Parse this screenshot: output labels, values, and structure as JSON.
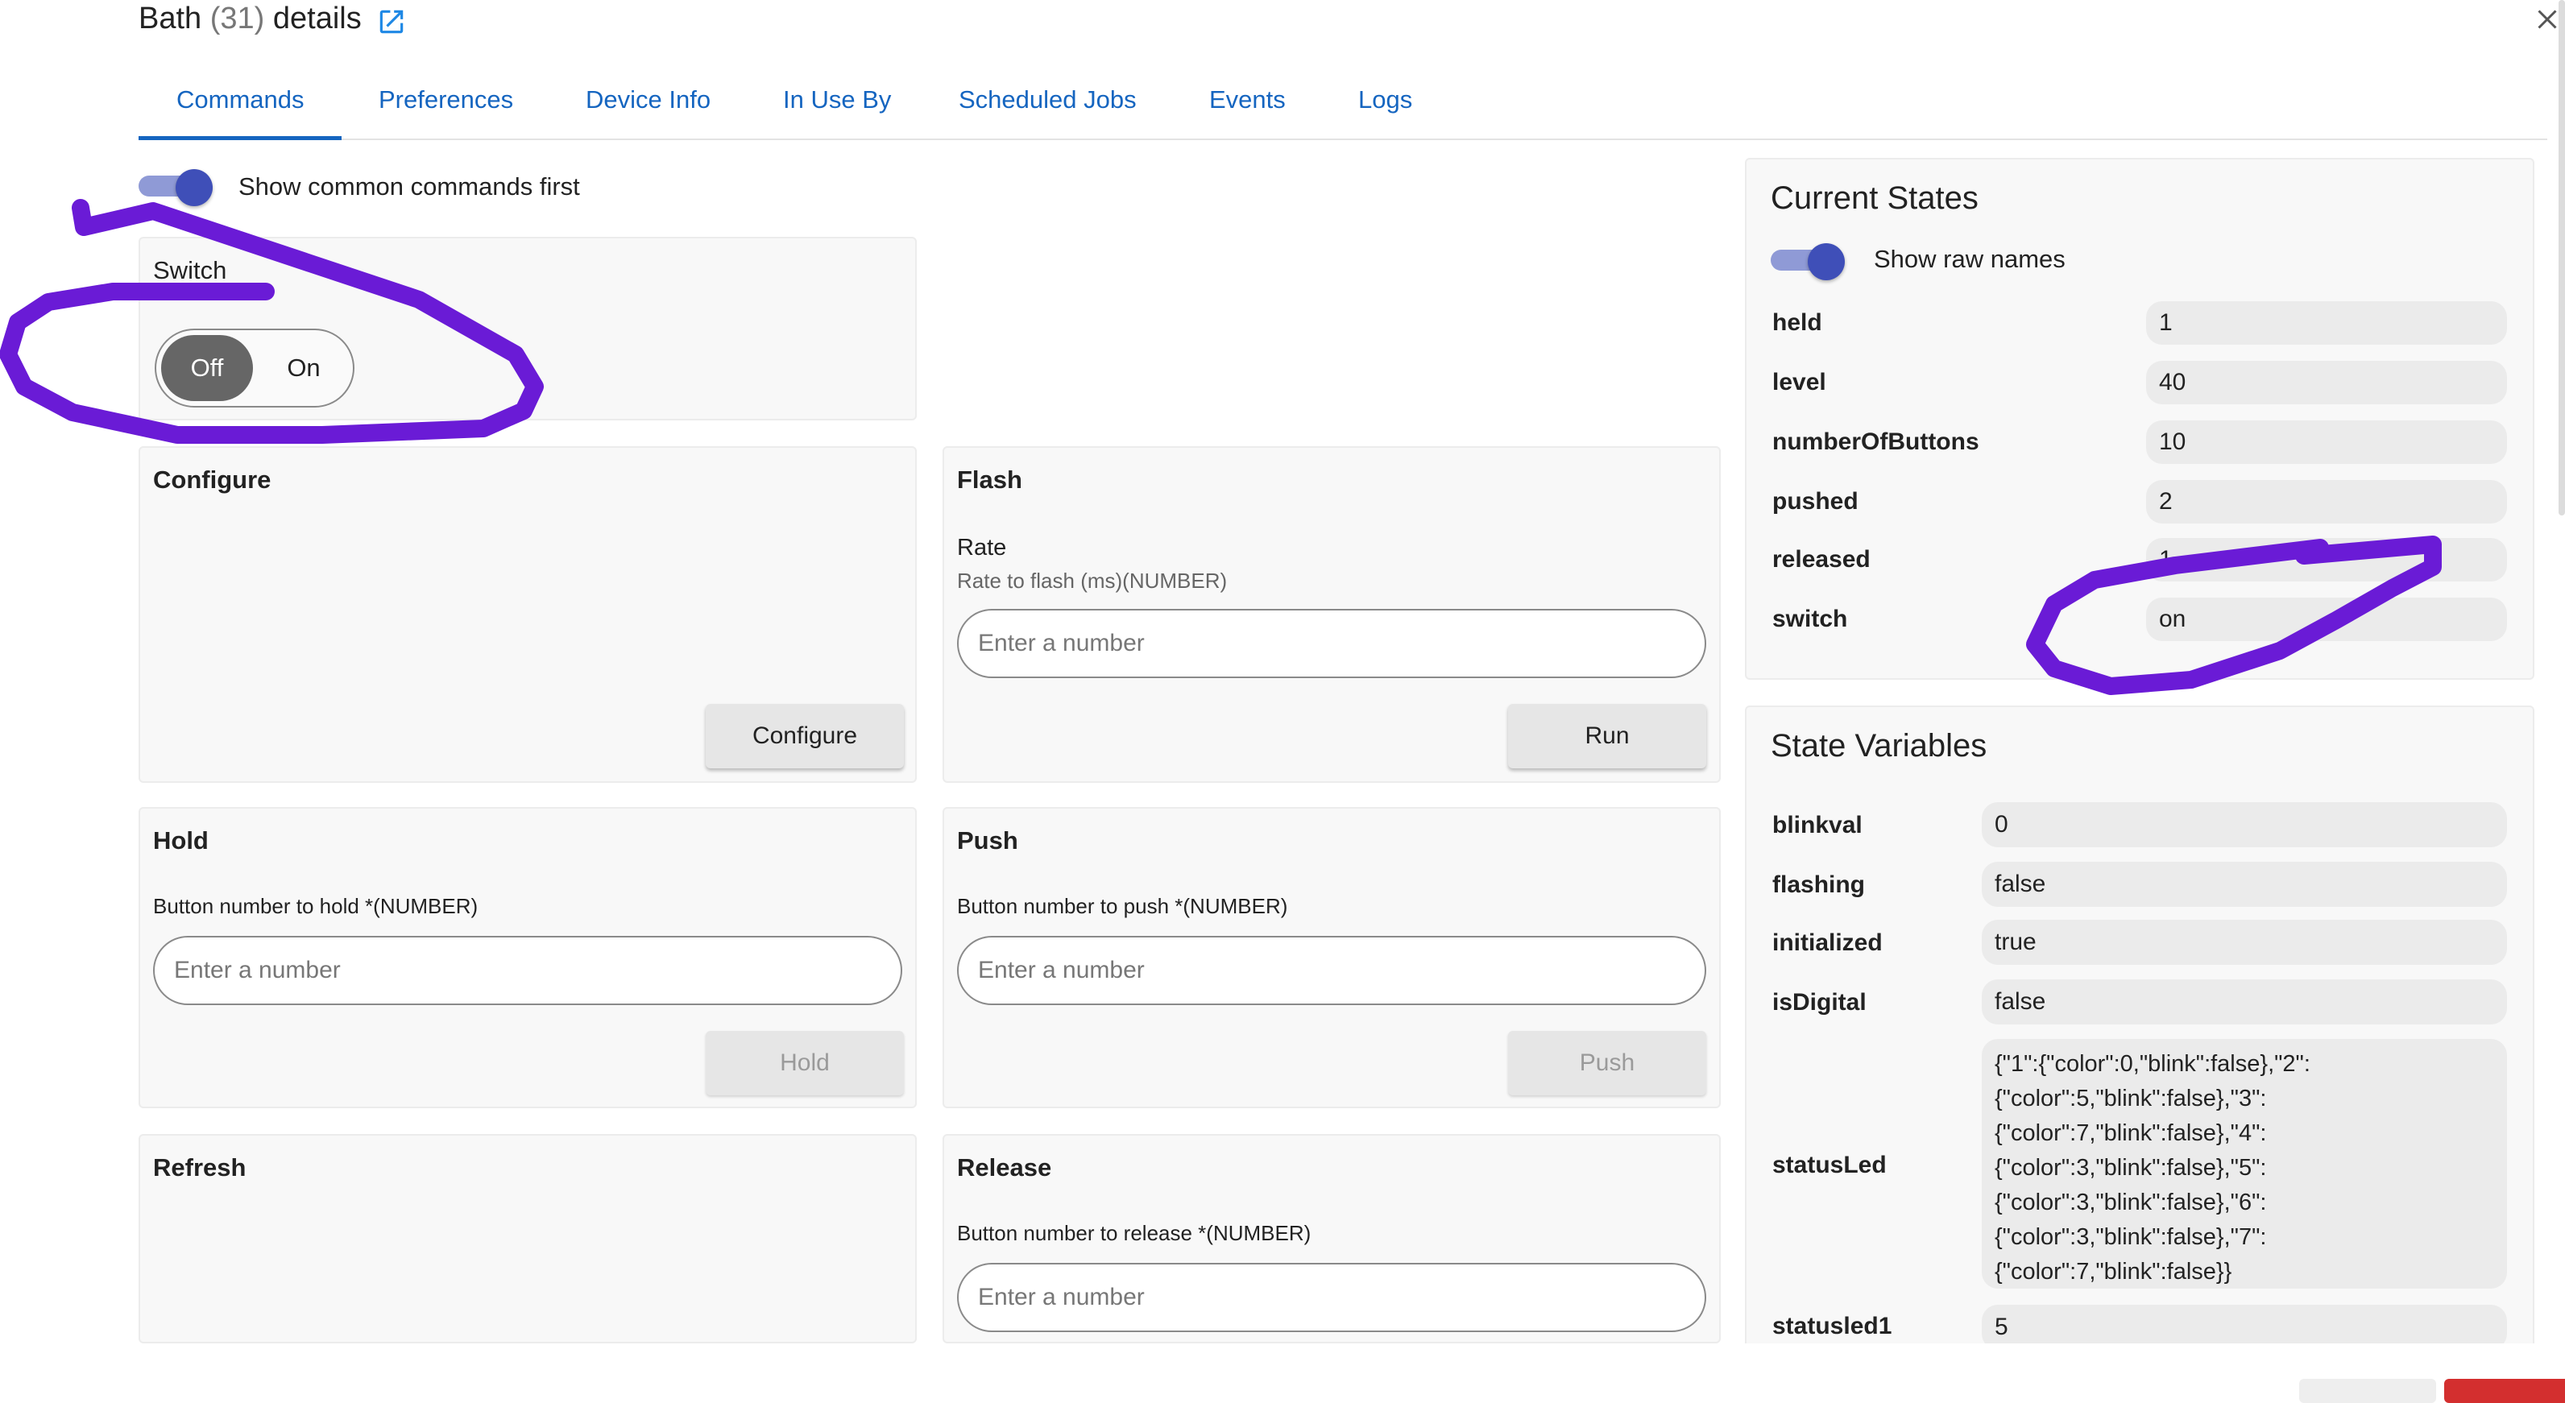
{
  "header": {
    "title_prefix": "Bath",
    "title_count": "(31)",
    "title_suffix": "details",
    "open_icon": "external-link-icon",
    "close_icon": "close-icon"
  },
  "tabs": [
    {
      "label": "Commands",
      "active": true
    },
    {
      "label": "Preferences"
    },
    {
      "label": "Device Info"
    },
    {
      "label": "In Use By"
    },
    {
      "label": "Scheduled Jobs"
    },
    {
      "label": "Events"
    },
    {
      "label": "Logs"
    }
  ],
  "commands": {
    "common_first_label": "Show common commands first",
    "switch": {
      "title": "Switch",
      "off_label": "Off",
      "on_label": "On",
      "selected": "Off"
    },
    "configure": {
      "title": "Configure",
      "button": "Configure"
    },
    "flash": {
      "title": "Flash",
      "param_name": "Rate",
      "param_hint": "Rate to flash (ms)(NUMBER)",
      "placeholder": "Enter a number",
      "button": "Run"
    },
    "hold": {
      "title": "Hold",
      "param_hint": "Button number to hold *(NUMBER)",
      "placeholder": "Enter a number",
      "button": "Hold"
    },
    "push": {
      "title": "Push",
      "param_hint": "Button number to push *(NUMBER)",
      "placeholder": "Enter a number",
      "button": "Push"
    },
    "refresh": {
      "title": "Refresh"
    },
    "release": {
      "title": "Release",
      "param_hint": "Button number to release *(NUMBER)",
      "placeholder": "Enter a number"
    }
  },
  "current_states": {
    "title": "Current States",
    "raw_names_label": "Show raw names",
    "rows": [
      {
        "name": "held",
        "value": "1"
      },
      {
        "name": "level",
        "value": "40"
      },
      {
        "name": "numberOfButtons",
        "value": "10"
      },
      {
        "name": "pushed",
        "value": "2"
      },
      {
        "name": "released",
        "value": "1"
      },
      {
        "name": "switch",
        "value": "on"
      }
    ]
  },
  "state_variables": {
    "title": "State Variables",
    "rows": [
      {
        "name": "blinkval",
        "value": "0"
      },
      {
        "name": "flashing",
        "value": "false"
      },
      {
        "name": "initialized",
        "value": "true"
      },
      {
        "name": "isDigital",
        "value": "false"
      },
      {
        "name": "statusLed",
        "lines": [
          "{\"1\":{\"color\":0,\"blink\":false},\"2\":",
          "{\"color\":5,\"blink\":false},\"3\":",
          "{\"color\":7,\"blink\":false},\"4\":",
          "{\"color\":3,\"blink\":false},\"5\":",
          "{\"color\":3,\"blink\":false},\"6\":",
          "{\"color\":3,\"blink\":false},\"7\":",
          "{\"color\":7,\"blink\":false}}"
        ]
      },
      {
        "name": "statusled1",
        "value": "5"
      }
    ]
  },
  "colors": {
    "accent": "#1565c0",
    "toggle": "#3f4fb8",
    "annotation": "#6a1bd6",
    "danger": "#d32f2f"
  }
}
